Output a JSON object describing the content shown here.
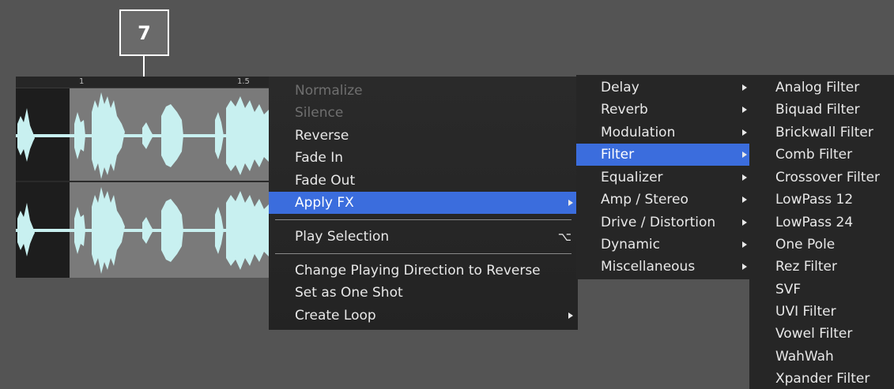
{
  "callout": {
    "number": "7"
  },
  "ruler": {
    "labels": [
      "1",
      "1.5"
    ]
  },
  "context_menu": {
    "items": [
      {
        "label": "Normalize",
        "enabled": false
      },
      {
        "label": "Silence",
        "enabled": false
      },
      {
        "label": "Reverse",
        "enabled": true
      },
      {
        "label": "Fade In",
        "enabled": true
      },
      {
        "label": "Fade Out",
        "enabled": true
      },
      {
        "label": "Apply FX",
        "enabled": true,
        "highlighted": true,
        "has_submenu": true
      },
      {
        "label": "Play Selection",
        "enabled": true,
        "shortcut": "⌥"
      },
      {
        "label": "Change Playing Direction to Reverse",
        "enabled": true
      },
      {
        "label": "Set as One Shot",
        "enabled": true
      },
      {
        "label": "Create Loop",
        "enabled": true,
        "has_submenu": true
      }
    ]
  },
  "fx_menu": {
    "items": [
      {
        "label": "Delay"
      },
      {
        "label": "Reverb"
      },
      {
        "label": "Modulation"
      },
      {
        "label": "Filter",
        "highlighted": true
      },
      {
        "label": "Equalizer"
      },
      {
        "label": "Amp / Stereo"
      },
      {
        "label": "Drive / Distortion"
      },
      {
        "label": "Dynamic"
      },
      {
        "label": "Miscellaneous"
      }
    ]
  },
  "filter_menu": {
    "items": [
      "Analog Filter",
      "Biquad Filter",
      "Brickwall Filter",
      "Comb Filter",
      "Crossover Filter",
      "LowPass 12",
      "LowPass 24",
      "One Pole",
      "Rez Filter",
      "SVF",
      "UVI Filter",
      "Vowel Filter",
      "WahWah",
      "Xpander Filter"
    ]
  },
  "colors": {
    "background": "#545454",
    "menu_highlight": "#3b6ddd",
    "waveform": "#c8f0f0"
  }
}
